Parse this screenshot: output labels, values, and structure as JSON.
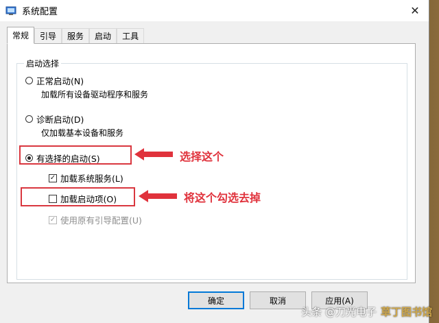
{
  "window": {
    "title": "系统配置",
    "close_glyph": "✕"
  },
  "tabs": [
    {
      "label": "常规",
      "active": true
    },
    {
      "label": "引导",
      "active": false
    },
    {
      "label": "服务",
      "active": false
    },
    {
      "label": "启动",
      "active": false
    },
    {
      "label": "工具",
      "active": false
    }
  ],
  "startup_group": {
    "legend": "启动选择",
    "normal": {
      "label": "正常启动(N)",
      "desc": "加载所有设备驱动程序和服务",
      "checked": false
    },
    "diagnostic": {
      "label": "诊断启动(D)",
      "desc": "仅加载基本设备和服务",
      "checked": false
    },
    "selective": {
      "label": "有选择的启动(S)",
      "checked": true
    },
    "load_system_services": {
      "label": "加载系统服务(L)",
      "checked": true
    },
    "load_startup_items": {
      "label": "加载启动项(O)",
      "checked": false
    },
    "use_original_boot": {
      "label": "使用原有引导配置(U)",
      "checked": true,
      "disabled": true
    }
  },
  "annotations": {
    "select_this": "选择这个",
    "uncheck_this": "将这个勾选去掉",
    "color": "#e0323c"
  },
  "buttons": {
    "ok": "确定",
    "cancel": "取消",
    "apply": "应用(A)"
  },
  "watermark": {
    "source": "头条 @刀光电子",
    "brand": "草丁图书馆"
  }
}
